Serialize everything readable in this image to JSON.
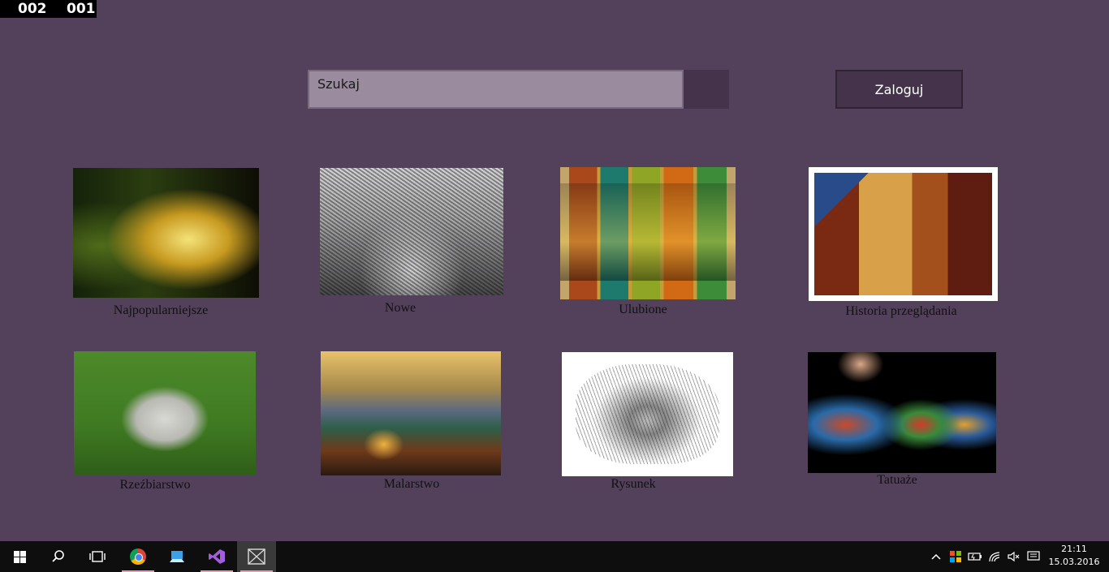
{
  "counter": {
    "left": "002",
    "right": "001"
  },
  "header": {
    "search_placeholder": "Szukaj",
    "login_label": "Zaloguj"
  },
  "tiles": [
    {
      "label": "Najpopularniejsze"
    },
    {
      "label": "Nowe"
    },
    {
      "label": "Ulubione"
    },
    {
      "label": "Historia przeglądania"
    },
    {
      "label": "Rzeźbiarstwo"
    },
    {
      "label": "Malarstwo"
    },
    {
      "label": "Rysunek"
    },
    {
      "label": "Tatuaże"
    }
  ],
  "taskbar": {
    "apps": [
      "windows-start",
      "search",
      "task-view",
      "chrome",
      "remote-desktop",
      "visual-studio",
      "app-window"
    ],
    "tray": [
      "chevron-up",
      "store",
      "power",
      "wifi",
      "volume-muted",
      "notifications"
    ],
    "time": "21:11",
    "date": "15.03.2016"
  }
}
